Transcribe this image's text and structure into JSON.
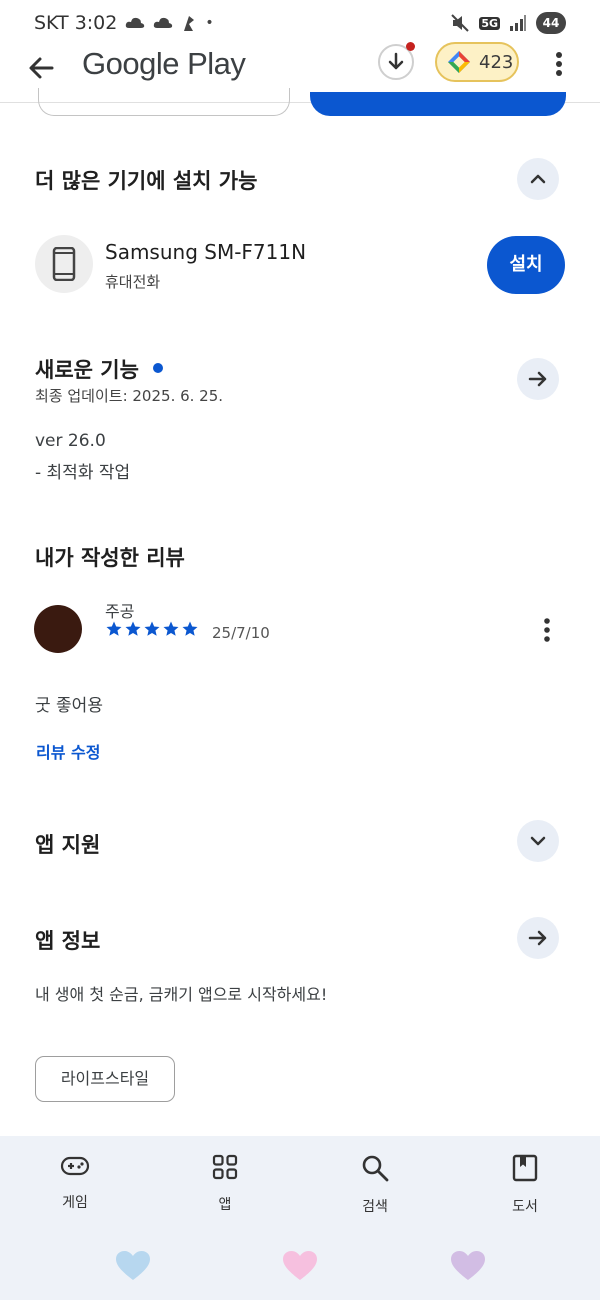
{
  "status_bar": {
    "carrier_time": "SKT 3:02",
    "network": "5G",
    "battery": "44"
  },
  "app_bar": {
    "title": "Google Play",
    "points": "423"
  },
  "more_devices": {
    "title": "더 많은 기기에 설치 가능",
    "device_name": "Samsung SM-F711N",
    "device_type": "휴대전화",
    "install_label": "설치"
  },
  "whats_new": {
    "title": "새로운 기능",
    "updated": "최종 업데이트: 2025. 6. 25.",
    "version": "ver 26.0",
    "notes": "- 최적화 작업"
  },
  "my_review": {
    "title": "내가 작성한 리뷰",
    "reviewer": "주공",
    "rating": 5,
    "date": "25/7/10",
    "text": "굿 좋어용",
    "edit_label": "리뷰 수정"
  },
  "app_support": {
    "title": "앱 지원"
  },
  "app_info": {
    "title": "앱 정보",
    "description": "내 생애 첫 순금, 금캐기 앱으로 시작하세요!",
    "category_chip": "라이프스타일"
  },
  "bottom_nav": {
    "items": [
      {
        "label": "게임",
        "icon": "gamepad-icon"
      },
      {
        "label": "앱",
        "icon": "apps-grid-icon"
      },
      {
        "label": "검색",
        "icon": "search-icon"
      },
      {
        "label": "도서",
        "icon": "book-icon"
      }
    ]
  },
  "colors": {
    "accent": "#0b57d0",
    "nav_background": "#eef2f8",
    "points_chip": "#fdf1c6"
  }
}
